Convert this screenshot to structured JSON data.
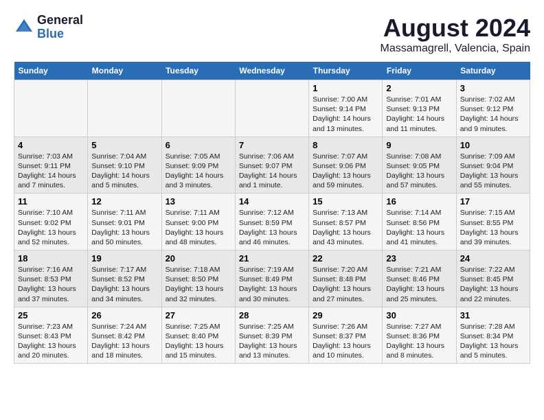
{
  "header": {
    "logo_line1": "General",
    "logo_line2": "Blue",
    "month_title": "August 2024",
    "location": "Massamagrell, Valencia, Spain"
  },
  "days_of_week": [
    "Sunday",
    "Monday",
    "Tuesday",
    "Wednesday",
    "Thursday",
    "Friday",
    "Saturday"
  ],
  "weeks": [
    [
      {
        "day": "",
        "text": ""
      },
      {
        "day": "",
        "text": ""
      },
      {
        "day": "",
        "text": ""
      },
      {
        "day": "",
        "text": ""
      },
      {
        "day": "1",
        "text": "Sunrise: 7:00 AM\nSunset: 9:14 PM\nDaylight: 14 hours\nand 13 minutes."
      },
      {
        "day": "2",
        "text": "Sunrise: 7:01 AM\nSunset: 9:13 PM\nDaylight: 14 hours\nand 11 minutes."
      },
      {
        "day": "3",
        "text": "Sunrise: 7:02 AM\nSunset: 9:12 PM\nDaylight: 14 hours\nand 9 minutes."
      }
    ],
    [
      {
        "day": "4",
        "text": "Sunrise: 7:03 AM\nSunset: 9:11 PM\nDaylight: 14 hours\nand 7 minutes."
      },
      {
        "day": "5",
        "text": "Sunrise: 7:04 AM\nSunset: 9:10 PM\nDaylight: 14 hours\nand 5 minutes."
      },
      {
        "day": "6",
        "text": "Sunrise: 7:05 AM\nSunset: 9:09 PM\nDaylight: 14 hours\nand 3 minutes."
      },
      {
        "day": "7",
        "text": "Sunrise: 7:06 AM\nSunset: 9:07 PM\nDaylight: 14 hours\nand 1 minute."
      },
      {
        "day": "8",
        "text": "Sunrise: 7:07 AM\nSunset: 9:06 PM\nDaylight: 13 hours\nand 59 minutes."
      },
      {
        "day": "9",
        "text": "Sunrise: 7:08 AM\nSunset: 9:05 PM\nDaylight: 13 hours\nand 57 minutes."
      },
      {
        "day": "10",
        "text": "Sunrise: 7:09 AM\nSunset: 9:04 PM\nDaylight: 13 hours\nand 55 minutes."
      }
    ],
    [
      {
        "day": "11",
        "text": "Sunrise: 7:10 AM\nSunset: 9:02 PM\nDaylight: 13 hours\nand 52 minutes."
      },
      {
        "day": "12",
        "text": "Sunrise: 7:11 AM\nSunset: 9:01 PM\nDaylight: 13 hours\nand 50 minutes."
      },
      {
        "day": "13",
        "text": "Sunrise: 7:11 AM\nSunset: 9:00 PM\nDaylight: 13 hours\nand 48 minutes."
      },
      {
        "day": "14",
        "text": "Sunrise: 7:12 AM\nSunset: 8:59 PM\nDaylight: 13 hours\nand 46 minutes."
      },
      {
        "day": "15",
        "text": "Sunrise: 7:13 AM\nSunset: 8:57 PM\nDaylight: 13 hours\nand 43 minutes."
      },
      {
        "day": "16",
        "text": "Sunrise: 7:14 AM\nSunset: 8:56 PM\nDaylight: 13 hours\nand 41 minutes."
      },
      {
        "day": "17",
        "text": "Sunrise: 7:15 AM\nSunset: 8:55 PM\nDaylight: 13 hours\nand 39 minutes."
      }
    ],
    [
      {
        "day": "18",
        "text": "Sunrise: 7:16 AM\nSunset: 8:53 PM\nDaylight: 13 hours\nand 37 minutes."
      },
      {
        "day": "19",
        "text": "Sunrise: 7:17 AM\nSunset: 8:52 PM\nDaylight: 13 hours\nand 34 minutes."
      },
      {
        "day": "20",
        "text": "Sunrise: 7:18 AM\nSunset: 8:50 PM\nDaylight: 13 hours\nand 32 minutes."
      },
      {
        "day": "21",
        "text": "Sunrise: 7:19 AM\nSunset: 8:49 PM\nDaylight: 13 hours\nand 30 minutes."
      },
      {
        "day": "22",
        "text": "Sunrise: 7:20 AM\nSunset: 8:48 PM\nDaylight: 13 hours\nand 27 minutes."
      },
      {
        "day": "23",
        "text": "Sunrise: 7:21 AM\nSunset: 8:46 PM\nDaylight: 13 hours\nand 25 minutes."
      },
      {
        "day": "24",
        "text": "Sunrise: 7:22 AM\nSunset: 8:45 PM\nDaylight: 13 hours\nand 22 minutes."
      }
    ],
    [
      {
        "day": "25",
        "text": "Sunrise: 7:23 AM\nSunset: 8:43 PM\nDaylight: 13 hours\nand 20 minutes."
      },
      {
        "day": "26",
        "text": "Sunrise: 7:24 AM\nSunset: 8:42 PM\nDaylight: 13 hours\nand 18 minutes."
      },
      {
        "day": "27",
        "text": "Sunrise: 7:25 AM\nSunset: 8:40 PM\nDaylight: 13 hours\nand 15 minutes."
      },
      {
        "day": "28",
        "text": "Sunrise: 7:25 AM\nSunset: 8:39 PM\nDaylight: 13 hours\nand 13 minutes."
      },
      {
        "day": "29",
        "text": "Sunrise: 7:26 AM\nSunset: 8:37 PM\nDaylight: 13 hours\nand 10 minutes."
      },
      {
        "day": "30",
        "text": "Sunrise: 7:27 AM\nSunset: 8:36 PM\nDaylight: 13 hours\nand 8 minutes."
      },
      {
        "day": "31",
        "text": "Sunrise: 7:28 AM\nSunset: 8:34 PM\nDaylight: 13 hours\nand 5 minutes."
      }
    ]
  ]
}
